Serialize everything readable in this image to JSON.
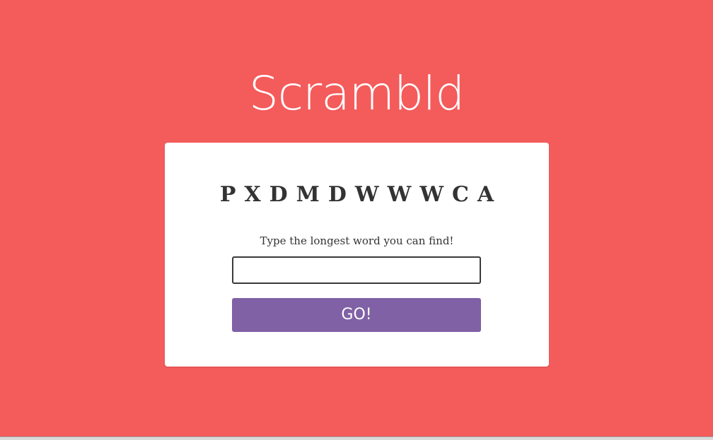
{
  "app": {
    "title": "Scrambld"
  },
  "puzzle": {
    "letters": [
      "P",
      "X",
      "D",
      "M",
      "D",
      "W",
      "W",
      "W",
      "C",
      "A"
    ],
    "prompt": "Type the longest word you can find!"
  },
  "input": {
    "value": "",
    "placeholder": ""
  },
  "button": {
    "label": "GO!"
  },
  "colors": {
    "background": "#f45b5b",
    "card": "#ffffff",
    "button": "#8061a5",
    "text": "#333333"
  }
}
